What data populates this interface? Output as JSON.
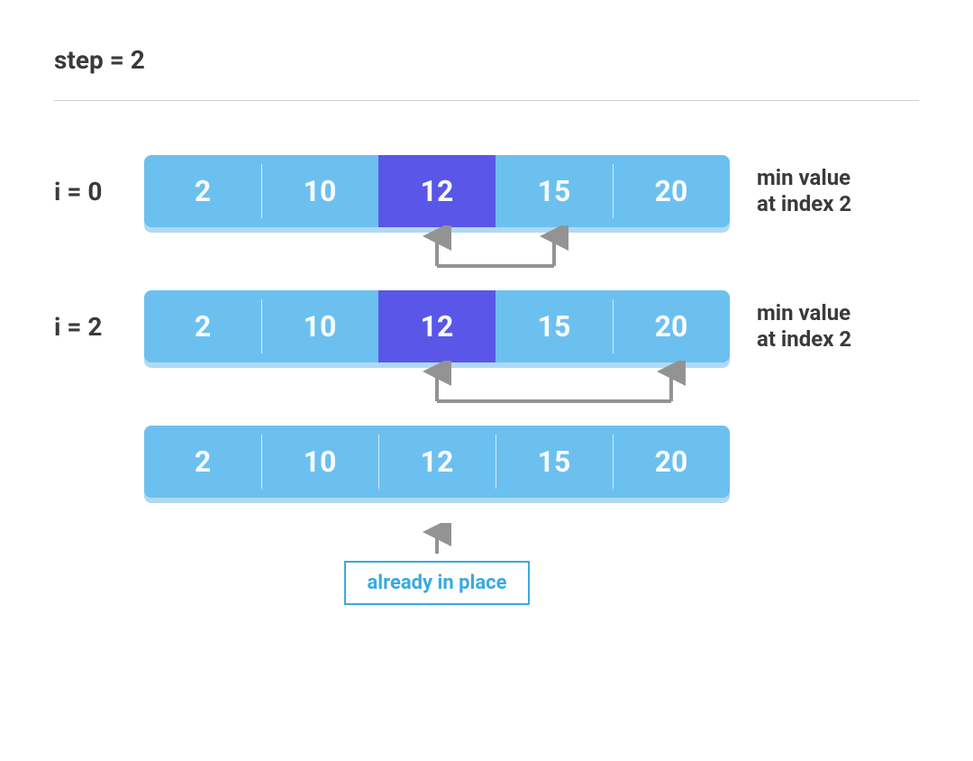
{
  "header": {
    "step_label": "step = 2"
  },
  "rows": [
    {
      "label": "i = 0",
      "cells": [
        "2",
        "10",
        "12",
        "15",
        "20"
      ],
      "highlight_index": 2,
      "note_line1": "min value",
      "note_line2": "at index 2",
      "connector_from_index": 2,
      "connector_to_index": 3
    },
    {
      "label": "i = 2",
      "cells": [
        "2",
        "10",
        "12",
        "15",
        "20"
      ],
      "highlight_index": 2,
      "note_line1": "min value",
      "note_line2": "at index 2",
      "connector_from_index": 2,
      "connector_to_index": 4
    },
    {
      "label": "",
      "cells": [
        "2",
        "10",
        "12",
        "15",
        "20"
      ],
      "highlight_index": -1,
      "callout_index": 2,
      "callout_text": "already in place"
    }
  ],
  "colors": {
    "cell_bg": "#6cc0ef",
    "highlight_bg": "#5a56e8",
    "connector": "#939393",
    "callout": "#3aa9e0",
    "text_dark": "#3a3a3a"
  }
}
